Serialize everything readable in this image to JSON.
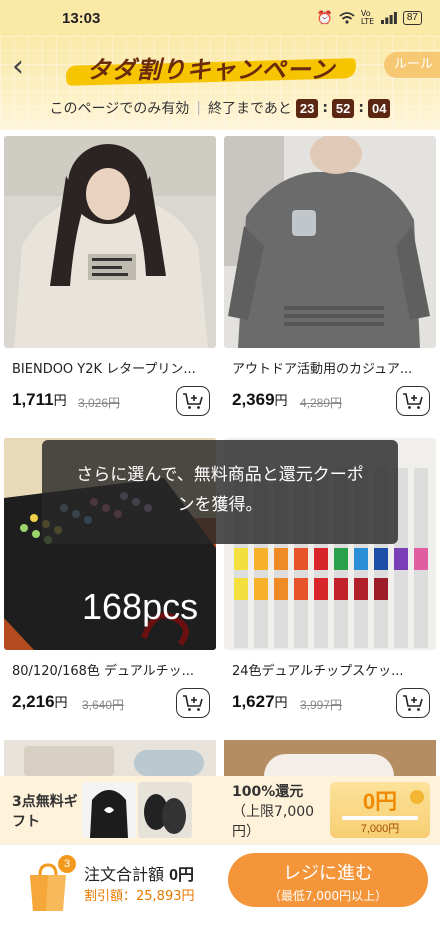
{
  "status_bar": {
    "time": "13:03",
    "battery": "87",
    "network": "Vo LTE"
  },
  "header": {
    "title": "タダ割りキャンペーン",
    "rules_label": "ルール",
    "notice": "このページでのみ有効",
    "timer_label": "終了まであと",
    "timer": {
      "hours": "23",
      "minutes": "52",
      "seconds": "04"
    }
  },
  "products": [
    {
      "name": "BIENDOO Y2K レタープリン...",
      "price": "1,711",
      "yen": "円",
      "original_price": "3,026円"
    },
    {
      "name": "アウトドア活動用のカジュア...",
      "price": "2,369",
      "yen": "円",
      "original_price": "4,289円"
    },
    {
      "name": "80/120/168色 デュアルチッ...",
      "price": "2,216",
      "yen": "円",
      "original_price": "3,640円",
      "image_text": "168pcs"
    },
    {
      "name": "24色デュアルチップスケッ...",
      "price": "1,627",
      "yen": "円",
      "original_price": "3,997円"
    }
  ],
  "toast": {
    "message": "さらに選んで、無料商品と還元クーポンを獲得。"
  },
  "gift_bar": {
    "label": "3点無料ギフト",
    "refund_text": "100%還元",
    "refund_limit": "（上限7,000円）",
    "coupon_amount": "0円",
    "coupon_cap": "7,000円"
  },
  "footer": {
    "cart_count": "3",
    "total_label": "注文合計額",
    "total_value": "0円",
    "discount_label": "割引額：25,893円",
    "checkout_label": "レジに進む",
    "checkout_sub": "（最低7,000円以上）"
  },
  "colors": {
    "accent": "#f5953a",
    "header_bg": "#fbe9a8",
    "timer_box": "#5b2712",
    "title": "#6a2a0c"
  }
}
